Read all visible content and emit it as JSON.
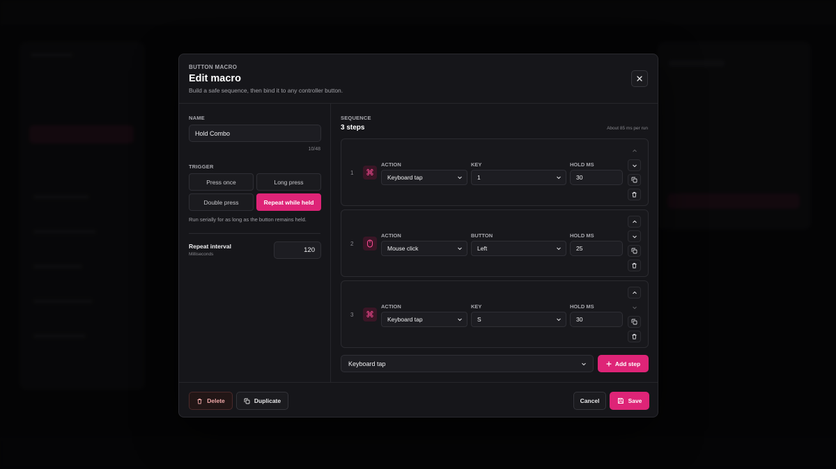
{
  "modal": {
    "eyebrow": "BUTTON MACRO",
    "title": "Edit macro",
    "subtitle": "Build a safe sequence, then bind it to any controller button."
  },
  "name": {
    "label": "NAME",
    "value": "Hold Combo",
    "counter": "10/48"
  },
  "trigger": {
    "label": "TRIGGER",
    "options": [
      "Press once",
      "Long press",
      "Double press",
      "Repeat while held"
    ],
    "selected": "Repeat while held",
    "hint": "Run serially for as long as the button remains held."
  },
  "repeat_interval": {
    "label": "Repeat interval",
    "unit": "Milliseconds",
    "value": "120"
  },
  "sequence": {
    "label": "SEQUENCE",
    "count": "3 steps",
    "runtime": "About 85 ms per run",
    "steps": [
      {
        "num": "1",
        "icon": "command-icon",
        "action_label": "ACTION",
        "action": "Keyboard tap",
        "key_label": "KEY",
        "key": "1",
        "hold_label": "HOLD MS",
        "hold": "30"
      },
      {
        "num": "2",
        "icon": "mouse-icon",
        "action_label": "ACTION",
        "action": "Mouse click",
        "key_label": "BUTTON",
        "key": "Left",
        "hold_label": "HOLD MS",
        "hold": "25"
      },
      {
        "num": "3",
        "icon": "command-icon",
        "action_label": "ACTION",
        "action": "Keyboard tap",
        "key_label": "KEY",
        "key": "S",
        "hold_label": "HOLD MS",
        "hold": "30"
      }
    ],
    "new_step_type": "Keyboard tap",
    "add_step_label": "Add step"
  },
  "footer": {
    "delete_label": "Delete",
    "duplicate_label": "Duplicate",
    "cancel_label": "Cancel",
    "save_label": "Save"
  },
  "colors": {
    "accent": "#de2477",
    "surface": "#16161a",
    "danger_text": "#f0a8a8"
  }
}
